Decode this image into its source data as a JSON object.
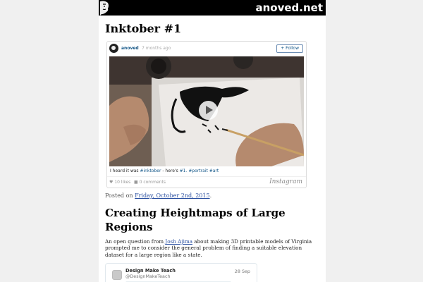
{
  "site": {
    "title": "anoved.net"
  },
  "post1": {
    "title": "Inktober #1",
    "instagram": {
      "username": "anoved",
      "separator": "•",
      "time": "7 months ago",
      "follow_label": "+ Follow",
      "caption_text": "I heard it was",
      "caption_tag1": "#inktober",
      "caption_mid": " - here's",
      "caption_tags_rest": "#1. #portrait #art",
      "likes": "10 likes",
      "comments": "0 comments",
      "brand": "Instagram"
    },
    "posted_prefix": "Posted on",
    "posted_date": "Friday, October 2nd, 2015",
    "posted_suffix": "."
  },
  "post2": {
    "title": "Creating Heightmaps of Large Regions",
    "excerpt_before": "An open question from",
    "excerpt_link": "Josh Ajima",
    "excerpt_after": "about making 3D printable models of Virginia prompted me to consider the general problem of finding a suitable elevation dataset for a large region like a state.",
    "tweet": {
      "name": "Design Make Teach",
      "handle": "@DesignMakeTeach",
      "date": "28 Sep"
    }
  },
  "colors": {
    "header_bg": "#000000",
    "link": "#2a4fa0",
    "instagram_link": "#125688"
  },
  "icons": {
    "logo": "portrait-logo-icon",
    "play": "play-icon",
    "heart": "heart-icon",
    "comment": "comment-icon"
  }
}
